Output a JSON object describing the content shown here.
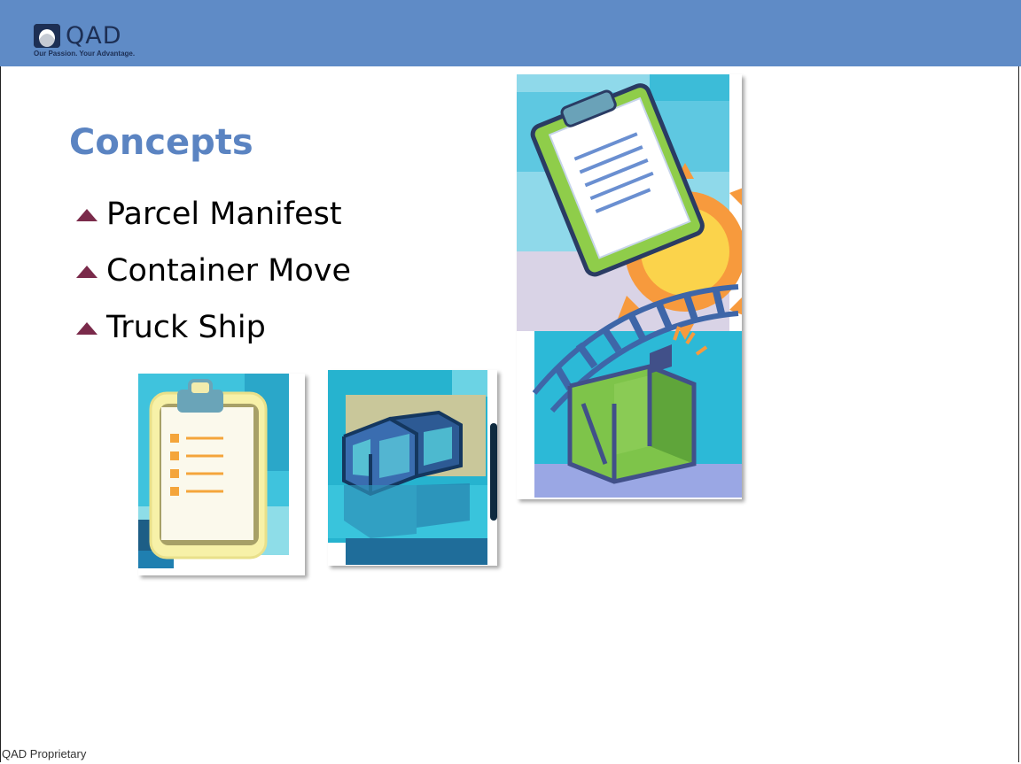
{
  "header": {
    "logo_text": "QAD",
    "tagline": "Our Passion. Your Advantage.",
    "logo_icon": "qad-logo-icon",
    "bar_color": "#5f8bc6"
  },
  "slide": {
    "title": "Concepts",
    "title_color": "#5b84c2",
    "bullet_icon": "triangle-bullet-icon",
    "bullet_color": "#7a2a4a",
    "bullets": [
      "Parcel Manifest",
      "Container Move",
      "Truck Ship"
    ]
  },
  "illustrations": [
    {
      "name": "clipboard-checklist-illustration"
    },
    {
      "name": "shipping-containers-illustration"
    },
    {
      "name": "clipboard-sun-railroad-container-illustration"
    }
  ],
  "footer": {
    "text": "QAD Proprietary"
  }
}
